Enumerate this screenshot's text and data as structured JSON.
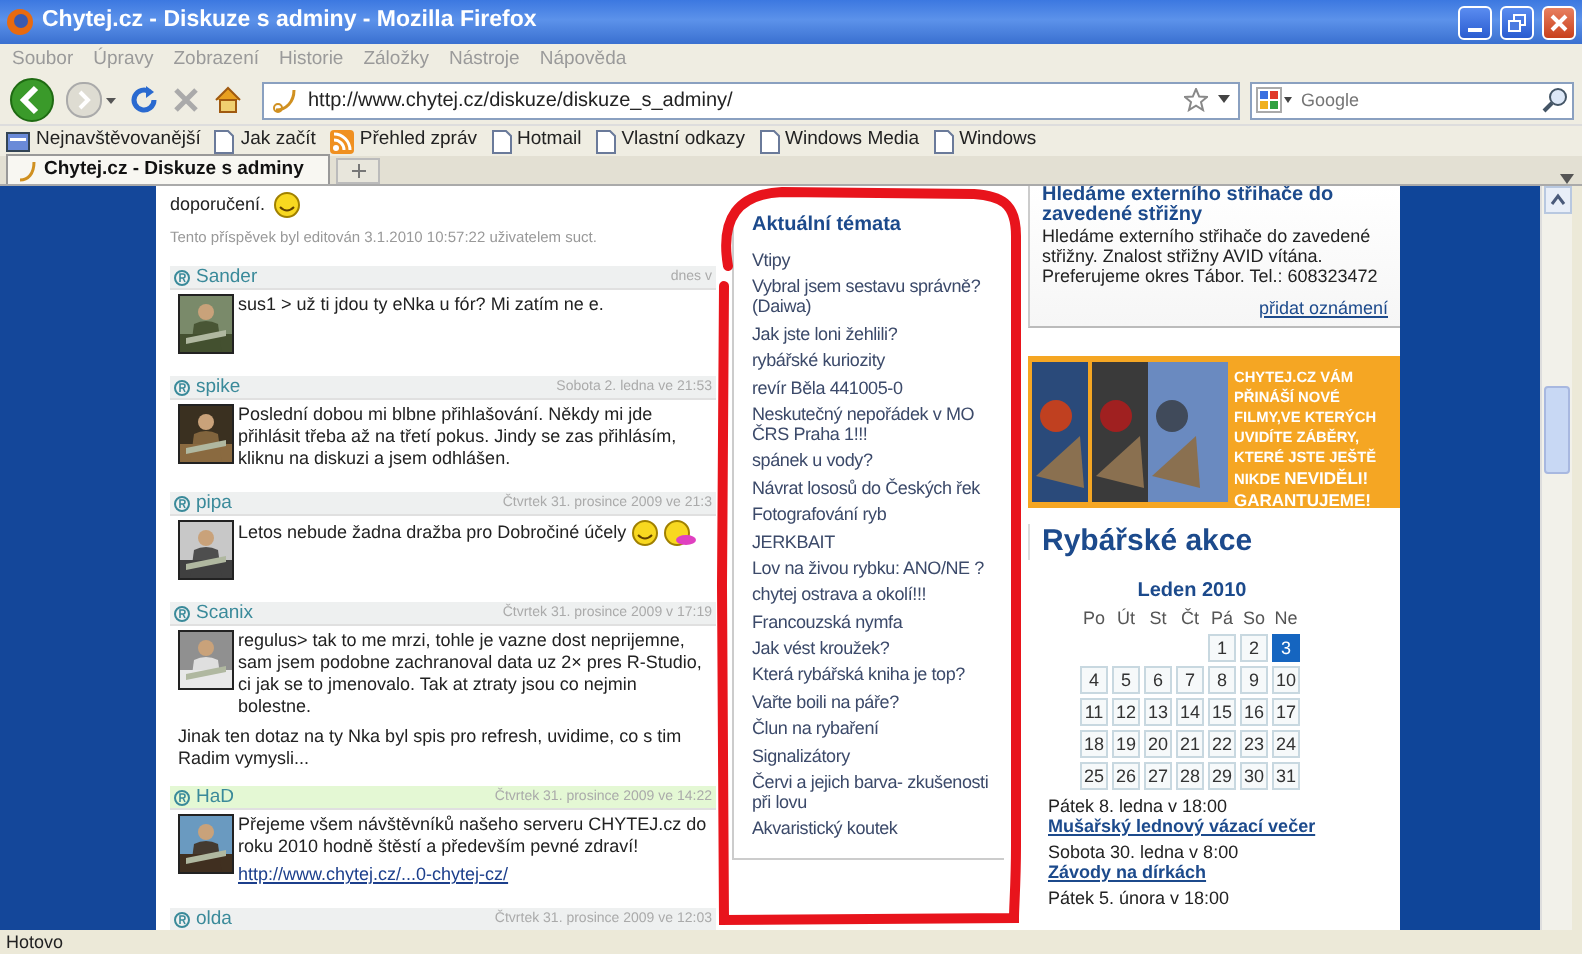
{
  "window": {
    "title": "Chytej.cz - Diskuze s adminy - Mozilla Firefox"
  },
  "menu": [
    "Soubor",
    "Úpravy",
    "Zobrazení",
    "Historie",
    "Záložky",
    "Nástroje",
    "Nápověda"
  ],
  "address": {
    "value": "http://www.chytej.cz/diskuze/diskuze_s_adminy/"
  },
  "search": {
    "placeholder": "Google"
  },
  "bookmarks": [
    {
      "label": "Nejnavštěvovanější",
      "kind": "smart"
    },
    {
      "label": "Jak začít",
      "kind": "page"
    },
    {
      "label": "Přehled zpráv",
      "kind": "feed"
    },
    {
      "label": "Hotmail",
      "kind": "page"
    },
    {
      "label": "Vlastní odkazy",
      "kind": "page"
    },
    {
      "label": "Windows Media",
      "kind": "page"
    },
    {
      "label": "Windows",
      "kind": "page"
    }
  ],
  "tabs": [
    {
      "label": "Chytej.cz - Diskuze s adminy",
      "selected": true
    }
  ],
  "forum": {
    "top_post": {
      "text": "doporučení.",
      "emoticons": [
        {
          "kind": "grin"
        }
      ],
      "edit_note": "Tento příspěvek byl editován 3.1.2010 10:57:22 uživatelem ",
      "edit_user": "suct",
      "edit_end": "."
    },
    "posts": [
      {
        "user": "Sander",
        "date": "dnes v",
        "highlighted": false,
        "text": "sus1 > už ti jdou ty eNka u fór? Mi zatím ne e."
      },
      {
        "user": "spike",
        "date": "Sobota 2. ledna ve 21:53",
        "highlighted": false,
        "text": "Poslední dobou mi blbne přihlašování. Někdy mi jde přihlásit třeba až na třetí pokus. Jindy se zas přihlásím, kliknu na diskuzi a jsem odhlášen."
      },
      {
        "user": "pipa",
        "date": "Čtvrtek 31. prosince 2009 ve 21:3",
        "highlighted": false,
        "text": "Letos nebude žadna dražba pro Dobročiné účely",
        "emoticons": [
          {
            "kind": "grin"
          },
          {
            "kind": "tongue"
          }
        ]
      },
      {
        "user": "Scanix",
        "date": "Čtvrtek 31. prosince 2009 v 17:19",
        "highlighted": false,
        "text": "regulus> tak to me mrzi, tohle je vazne dost neprijemne, sam jsem podobne zachranoval data uz 2× pres R-Studio, ci jak se to jmenovalo. Tak at ztraty jsou co nejmin bolestne.",
        "extra": "Jinak ten dotaz na ty Nka byl spis pro refresh, uvidime, co s tim Radim vymysli..."
      },
      {
        "user": "HaD",
        "date": "Čtvrtek 31. prosince 2009 ve 14:22",
        "highlighted": true,
        "text": "Přejeme všem návštěvníků našeho serveru CHYTEJ.cz do roku 2010 hodně štěstí a především pevné zdraví!",
        "link": "http://www.chytej.cz/...0-chytej-cz/"
      },
      {
        "user": "olda",
        "date": "Čtvrtek 31. prosince 2009 ve 12:03",
        "highlighted": false
      }
    ]
  },
  "topics": {
    "title": "Aktuální témata",
    "items": [
      "Vtipy",
      "Vybral jsem sestavu správně?(Daiwa)",
      "Jak jste loni žehlili?",
      "rybářské kuriozity",
      "revír Běla 441005-0",
      "Neskutečný nepořádek v MO ČRS Praha 1!!!",
      "spánek u vody?",
      "Návrat lososů do Českých řek",
      "Fotografování ryb",
      "JERKBAIT",
      "Lov na živou rybku: ANO/NE ?",
      "chytej ostrava a okolí!!!",
      "Francouzská nymfa",
      "Jak vést kroužek?",
      "Která rybářská kniha je top?",
      "Vařte boili na páře?",
      "Člun na rybaření",
      "Signalizátory",
      "Červi a jejich barva- zkušenosti při lovu",
      "Akvaristický koutek"
    ]
  },
  "notice": {
    "title": "Hledáme externího střihače do zavedené střižny",
    "text": "Hledáme externího střihače do zavedené střižny. Znalost střižny AVID vítána. Preferujeme okres Tábor. Tel.: 608323472",
    "link": "přidat oznámení"
  },
  "banner": {
    "kind": "picture",
    "text": "CHYTEJ.CZ VÁM PŘINÁŠÍ NOVÉ FILMY,VE KTERÝCH UVIDÍTE ZÁBĚRY, KTERÉ JSTE JEŠTĚ NIKDE",
    "emphasis": "NEVIDĚLI! GARANTUJEME!"
  },
  "events": {
    "title": "Rybářské akce",
    "calendar": {
      "month": "Leden 2010",
      "weekdays": [
        "Po",
        "Út",
        "St",
        "Čt",
        "Pá",
        "So",
        "Ne"
      ],
      "weeks": [
        [
          {
            "day": "1",
            "selected": false
          },
          {
            "day": "2",
            "selected": false
          },
          {
            "day": "3",
            "selected": true
          }
        ],
        [
          {
            "day": "4",
            "selected": false
          },
          {
            "day": "5",
            "selected": false
          },
          {
            "day": "6",
            "selected": false
          },
          {
            "day": "7",
            "selected": false
          },
          {
            "day": "8",
            "selected": false
          },
          {
            "day": "9",
            "selected": false
          },
          {
            "day": "10",
            "selected": false
          }
        ],
        [
          {
            "day": "11",
            "selected": false
          },
          {
            "day": "12",
            "selected": false
          },
          {
            "day": "13",
            "selected": false
          },
          {
            "day": "14",
            "selected": false
          },
          {
            "day": "15",
            "selected": false
          },
          {
            "day": "16",
            "selected": false
          },
          {
            "day": "17",
            "selected": false
          }
        ],
        [
          {
            "day": "18",
            "selected": false
          },
          {
            "day": "19",
            "selected": false
          },
          {
            "day": "20",
            "selected": false
          },
          {
            "day": "21",
            "selected": false
          },
          {
            "day": "22",
            "selected": false
          },
          {
            "day": "23",
            "selected": false
          },
          {
            "day": "24",
            "selected": false
          }
        ],
        [
          {
            "day": "25",
            "selected": false
          },
          {
            "day": "26",
            "selected": false
          },
          {
            "day": "27",
            "selected": false
          },
          {
            "day": "28",
            "selected": false
          },
          {
            "day": "29",
            "selected": false
          },
          {
            "day": "30",
            "selected": false
          },
          {
            "day": "31",
            "selected": false
          }
        ]
      ]
    },
    "items": [
      {
        "date": "Pátek 8. ledna v 18:00",
        "title": "Mušařský lednový vázací večer"
      },
      {
        "date": "Sobota 30. ledna v 8:00",
        "title": "Závody na dírkách"
      },
      {
        "date": "Pátek 5. února v 18:00"
      }
    ]
  },
  "status_bar": "Hotovo"
}
